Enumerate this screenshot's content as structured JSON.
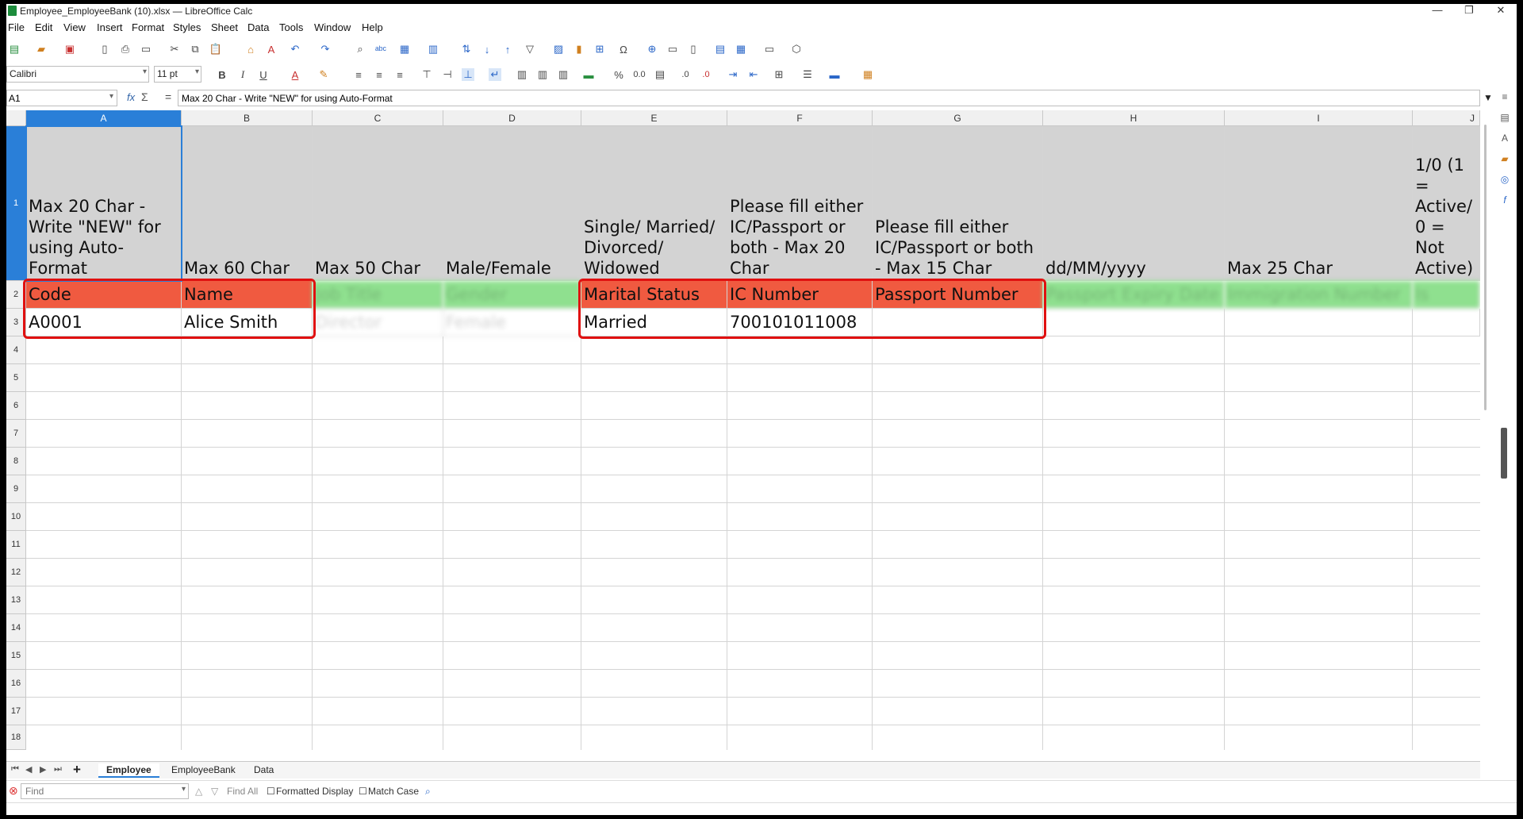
{
  "window": {
    "title": "Employee_EmployeeBank (10).xlsx — LibreOffice Calc",
    "minimize": "—",
    "maximize": "❐",
    "close": "✕"
  },
  "menu": [
    "File",
    "Edit",
    "View",
    "Insert",
    "Format",
    "Styles",
    "Sheet",
    "Data",
    "Tools",
    "Window",
    "Help"
  ],
  "toolbar2": {
    "font_name": "Calibri",
    "font_size": "11 pt",
    "bold": "B",
    "italic": "I",
    "underline": "U",
    "percent": "%",
    "number": "0.0"
  },
  "formula": {
    "cell_ref": "A1",
    "fx": "fx",
    "sigma": "Σ",
    "equals": "=",
    "content": "Max 20 Char - Write \"NEW\" for using Auto-Format"
  },
  "columns": [
    "A",
    "B",
    "C",
    "D",
    "E",
    "F",
    "G",
    "H",
    "I",
    "J"
  ],
  "rows": [
    "1",
    "2",
    "3",
    "4",
    "5",
    "6",
    "7",
    "8",
    "9",
    "10",
    "11",
    "12",
    "13",
    "14",
    "15",
    "16",
    "17",
    "18"
  ],
  "row1": [
    "Max 20 Char - Write \"NEW\" for using Auto-Format",
    "Max 60 Char",
    "Max 50 Char",
    "Male/Female",
    "Single/ Married/ Divorced/ Widowed",
    "Please fill either IC/Passport or both - Max 20 Char",
    "Please fill either IC/Passport or both - Max 15 Char",
    "dd/MM/yyyy",
    "Max 25 Char",
    "1/0 (1 = Active/ 0 = Not Active)"
  ],
  "row2": [
    "Code",
    "Name",
    "Job Title",
    "Gender",
    "Marital Status",
    "IC Number",
    "Passport Number",
    "Passport Expiry Date",
    "Immigration Number",
    "Is Disabled"
  ],
  "row3": [
    "A0001",
    "Alice Smith",
    "Director",
    "Female",
    "Married",
    "700101011008",
    "",
    "",
    "",
    ""
  ],
  "tabs": {
    "add": "+",
    "sheets": [
      "Employee",
      "EmployeeBank",
      "Data"
    ],
    "active": "Employee"
  },
  "findbar": {
    "placeholder": "Find",
    "find_all": "Find All",
    "formatted_display": "Formatted Display",
    "match_case": "Match Case"
  },
  "colors": {
    "header_orange": "#f05a40",
    "header_green": "#8fe08f",
    "selection_blue": "#2a7fd8",
    "annotation_red": "#e01010"
  }
}
